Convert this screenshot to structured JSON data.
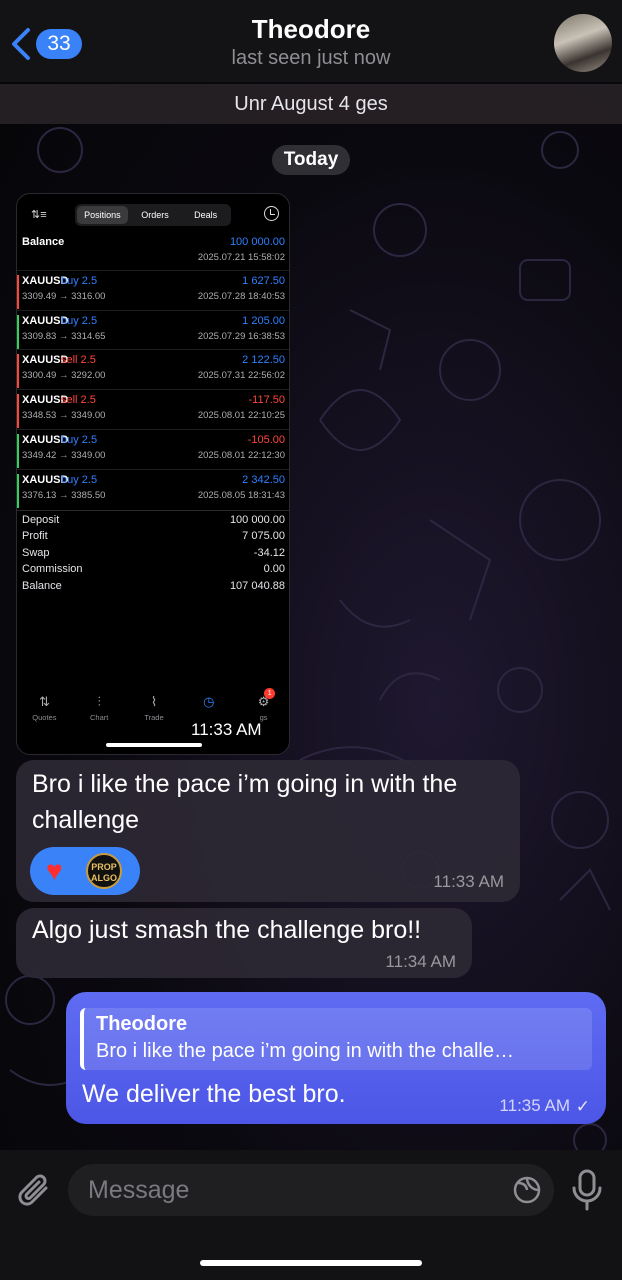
{
  "header": {
    "back_count": "33",
    "title": "Theodore",
    "status": "last seen just now"
  },
  "pinned": {
    "text": "Unr August 4 ges"
  },
  "date_chip": "Today",
  "screenshot": {
    "segments": [
      "Positions",
      "Orders",
      "Deals"
    ],
    "balance_label": "Balance",
    "balance_value": "100 000.00",
    "balance_date": "2025.07.21 15:58:02",
    "trades": [
      {
        "symbol": "XAUUSD",
        "side": "buy 2.5",
        "prices": "3309.49 → 3316.00",
        "profit": "1 627.50",
        "date": "2025.07.28 18:40:53",
        "color": "#2f80ff",
        "bar": "#ff453a"
      },
      {
        "symbol": "XAUUSD",
        "side": "buy 2.5",
        "prices": "3309.83 → 3314.65",
        "profit": "1 205.00",
        "date": "2025.07.29 16:38:53",
        "color": "#2f80ff",
        "bar": "#30d158"
      },
      {
        "symbol": "XAUUSD",
        "side": "sell 2.5",
        "prices": "3300.49 → 3292.00",
        "profit": "2 122.50",
        "date": "2025.07.31 22:56:02",
        "color": "#2f80ff",
        "bar": "#ff453a"
      },
      {
        "symbol": "XAUUSD",
        "side": "sell 2.5",
        "prices": "3348.53 → 3349.00",
        "profit": "-117.50",
        "date": "2025.08.01 22:10:25",
        "color": "#ff453a",
        "bar": "#ff453a"
      },
      {
        "symbol": "XAUUSD",
        "side": "buy 2.5",
        "prices": "3349.42 → 3349.00",
        "profit": "-105.00",
        "date": "2025.08.01 22:12:30",
        "color": "#ff453a",
        "bar": "#30d158"
      },
      {
        "symbol": "XAUUSD",
        "side": "buy 2.5",
        "prices": "3376.13 → 3385.50",
        "profit": "2 342.50",
        "date": "2025.08.05 18:31:43",
        "color": "#2f80ff",
        "bar": "#30d158"
      }
    ],
    "summary": [
      {
        "k": "Deposit",
        "v": "100 000.00"
      },
      {
        "k": "Profit",
        "v": "7 075.00"
      },
      {
        "k": "Swap",
        "v": "-34.12"
      },
      {
        "k": "Commission",
        "v": "0.00"
      },
      {
        "k": "Balance",
        "v": "107 040.88"
      }
    ],
    "tabs": [
      {
        "label": "Quotes",
        "icon": "quotes-icon"
      },
      {
        "label": "Chart",
        "icon": "chart-icon"
      },
      {
        "label": "Trade",
        "icon": "trade-icon"
      },
      {
        "label": "",
        "icon": "history-icon"
      },
      {
        "label": "gs",
        "icon": "settings-icon"
      }
    ],
    "notif_count": "1",
    "time": "11:33 AM"
  },
  "messages": [
    {
      "text_line1": "Bro i like the pace i’m going in with the",
      "text_line2": "challenge",
      "time": "11:33 AM",
      "reaction_logo": "PROP ALGO"
    },
    {
      "text": "Algo just smash the challenge bro!!",
      "time": "11:34 AM"
    }
  ],
  "outgoing": {
    "reply_name": "Theodore",
    "reply_text": "Bro i like the pace i’m going in with the challe…",
    "text": "We deliver the best bro.",
    "time": "11:35 AM"
  },
  "input": {
    "placeholder": "Message"
  },
  "colors": {
    "accent": "#3a82f7",
    "outgoing_bubble": "#5560ee"
  }
}
